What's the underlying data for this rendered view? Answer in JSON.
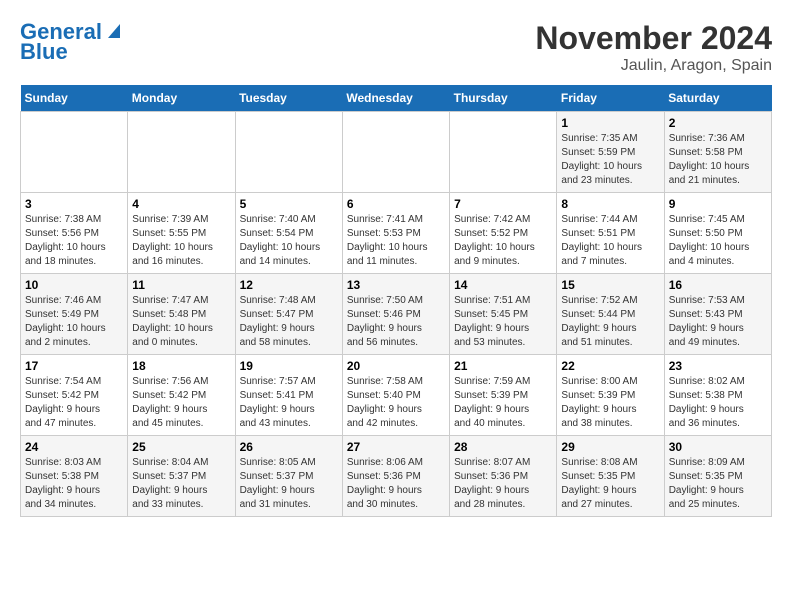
{
  "logo": {
    "line1": "General",
    "line2": "Blue"
  },
  "title": "November 2024",
  "location": "Jaulin, Aragon, Spain",
  "days_of_week": [
    "Sunday",
    "Monday",
    "Tuesday",
    "Wednesday",
    "Thursday",
    "Friday",
    "Saturday"
  ],
  "weeks": [
    [
      {
        "day": "",
        "info": ""
      },
      {
        "day": "",
        "info": ""
      },
      {
        "day": "",
        "info": ""
      },
      {
        "day": "",
        "info": ""
      },
      {
        "day": "",
        "info": ""
      },
      {
        "day": "1",
        "info": "Sunrise: 7:35 AM\nSunset: 5:59 PM\nDaylight: 10 hours\nand 23 minutes."
      },
      {
        "day": "2",
        "info": "Sunrise: 7:36 AM\nSunset: 5:58 PM\nDaylight: 10 hours\nand 21 minutes."
      }
    ],
    [
      {
        "day": "3",
        "info": "Sunrise: 7:38 AM\nSunset: 5:56 PM\nDaylight: 10 hours\nand 18 minutes."
      },
      {
        "day": "4",
        "info": "Sunrise: 7:39 AM\nSunset: 5:55 PM\nDaylight: 10 hours\nand 16 minutes."
      },
      {
        "day": "5",
        "info": "Sunrise: 7:40 AM\nSunset: 5:54 PM\nDaylight: 10 hours\nand 14 minutes."
      },
      {
        "day": "6",
        "info": "Sunrise: 7:41 AM\nSunset: 5:53 PM\nDaylight: 10 hours\nand 11 minutes."
      },
      {
        "day": "7",
        "info": "Sunrise: 7:42 AM\nSunset: 5:52 PM\nDaylight: 10 hours\nand 9 minutes."
      },
      {
        "day": "8",
        "info": "Sunrise: 7:44 AM\nSunset: 5:51 PM\nDaylight: 10 hours\nand 7 minutes."
      },
      {
        "day": "9",
        "info": "Sunrise: 7:45 AM\nSunset: 5:50 PM\nDaylight: 10 hours\nand 4 minutes."
      }
    ],
    [
      {
        "day": "10",
        "info": "Sunrise: 7:46 AM\nSunset: 5:49 PM\nDaylight: 10 hours\nand 2 minutes."
      },
      {
        "day": "11",
        "info": "Sunrise: 7:47 AM\nSunset: 5:48 PM\nDaylight: 10 hours\nand 0 minutes."
      },
      {
        "day": "12",
        "info": "Sunrise: 7:48 AM\nSunset: 5:47 PM\nDaylight: 9 hours\nand 58 minutes."
      },
      {
        "day": "13",
        "info": "Sunrise: 7:50 AM\nSunset: 5:46 PM\nDaylight: 9 hours\nand 56 minutes."
      },
      {
        "day": "14",
        "info": "Sunrise: 7:51 AM\nSunset: 5:45 PM\nDaylight: 9 hours\nand 53 minutes."
      },
      {
        "day": "15",
        "info": "Sunrise: 7:52 AM\nSunset: 5:44 PM\nDaylight: 9 hours\nand 51 minutes."
      },
      {
        "day": "16",
        "info": "Sunrise: 7:53 AM\nSunset: 5:43 PM\nDaylight: 9 hours\nand 49 minutes."
      }
    ],
    [
      {
        "day": "17",
        "info": "Sunrise: 7:54 AM\nSunset: 5:42 PM\nDaylight: 9 hours\nand 47 minutes."
      },
      {
        "day": "18",
        "info": "Sunrise: 7:56 AM\nSunset: 5:42 PM\nDaylight: 9 hours\nand 45 minutes."
      },
      {
        "day": "19",
        "info": "Sunrise: 7:57 AM\nSunset: 5:41 PM\nDaylight: 9 hours\nand 43 minutes."
      },
      {
        "day": "20",
        "info": "Sunrise: 7:58 AM\nSunset: 5:40 PM\nDaylight: 9 hours\nand 42 minutes."
      },
      {
        "day": "21",
        "info": "Sunrise: 7:59 AM\nSunset: 5:39 PM\nDaylight: 9 hours\nand 40 minutes."
      },
      {
        "day": "22",
        "info": "Sunrise: 8:00 AM\nSunset: 5:39 PM\nDaylight: 9 hours\nand 38 minutes."
      },
      {
        "day": "23",
        "info": "Sunrise: 8:02 AM\nSunset: 5:38 PM\nDaylight: 9 hours\nand 36 minutes."
      }
    ],
    [
      {
        "day": "24",
        "info": "Sunrise: 8:03 AM\nSunset: 5:38 PM\nDaylight: 9 hours\nand 34 minutes."
      },
      {
        "day": "25",
        "info": "Sunrise: 8:04 AM\nSunset: 5:37 PM\nDaylight: 9 hours\nand 33 minutes."
      },
      {
        "day": "26",
        "info": "Sunrise: 8:05 AM\nSunset: 5:37 PM\nDaylight: 9 hours\nand 31 minutes."
      },
      {
        "day": "27",
        "info": "Sunrise: 8:06 AM\nSunset: 5:36 PM\nDaylight: 9 hours\nand 30 minutes."
      },
      {
        "day": "28",
        "info": "Sunrise: 8:07 AM\nSunset: 5:36 PM\nDaylight: 9 hours\nand 28 minutes."
      },
      {
        "day": "29",
        "info": "Sunrise: 8:08 AM\nSunset: 5:35 PM\nDaylight: 9 hours\nand 27 minutes."
      },
      {
        "day": "30",
        "info": "Sunrise: 8:09 AM\nSunset: 5:35 PM\nDaylight: 9 hours\nand 25 minutes."
      }
    ]
  ]
}
